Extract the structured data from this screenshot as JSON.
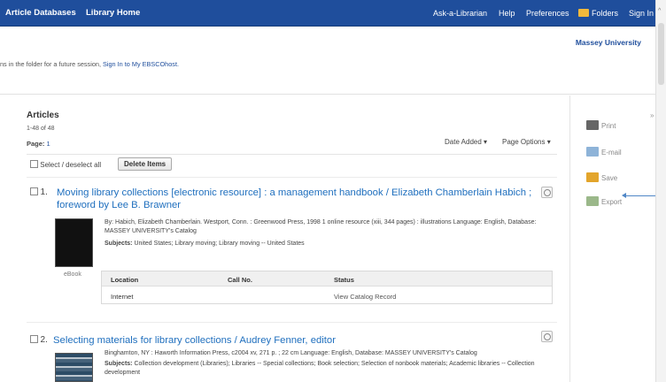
{
  "nav": {
    "article_databases": "Article Databases",
    "library_home": "Library Home",
    "ask": "Ask-a-Librarian",
    "help": "Help",
    "preferences": "Preferences",
    "folders": "Folders",
    "sign_in": "Sign In"
  },
  "header": {
    "institution": "Massey University",
    "notice_text": "ns in the folder for a future session, ",
    "notice_link": "Sign In to My EBSCOhost."
  },
  "articles": {
    "heading": "Articles",
    "count": "1-48 of 48",
    "page_label": "Page:",
    "page_value": "1",
    "sort_label": "Date Added ▾",
    "options_label": "Page Options ▾",
    "select_all": "Select / deselect all",
    "delete_button": "Delete Items"
  },
  "results": [
    {
      "number": "1.",
      "title": "Moving library collections [electronic resource] : a management handbook / Elizabeth Chamberlain Habich ; foreword by Lee B. Brawner",
      "desc": "By: Habich, Elizabeth Chamberlain. Westport, Conn. : Greenwood Press, 1998 1 online resource (xiii, 344 pages) : illustrations Language: English, Database: MASSEY UNIVERSITY's Catalog",
      "subjects_label": "Subjects:",
      "subjects": "United States; Library moving; Library moving -- United States",
      "format": "eBook",
      "holdings": {
        "headers": [
          "Location",
          "Call No.",
          "Status"
        ],
        "row": [
          "Internet",
          "",
          "View Catalog Record"
        ]
      }
    },
    {
      "number": "2.",
      "title": "Selecting materials for library collections / Audrey Fenner, editor",
      "desc": "Binghamton, NY : Haworth Information Press, c2004 xv, 271 p. ; 22 cm Language: English, Database: MASSEY UNIVERSITY's Catalog",
      "subjects_label": "Subjects:",
      "subjects": "Collection development (Libraries); Libraries -- Special collections; Book selection; Selection of nonbook materials; Academic libraries -- Collection development"
    }
  ],
  "tools": {
    "print": "Print",
    "email": "E-mail",
    "save": "Save",
    "export": "Export"
  },
  "colors": {
    "nav_bg": "#1f4e9c",
    "link": "#1f6fbe",
    "annotation_arrow": "#4f86c6"
  }
}
